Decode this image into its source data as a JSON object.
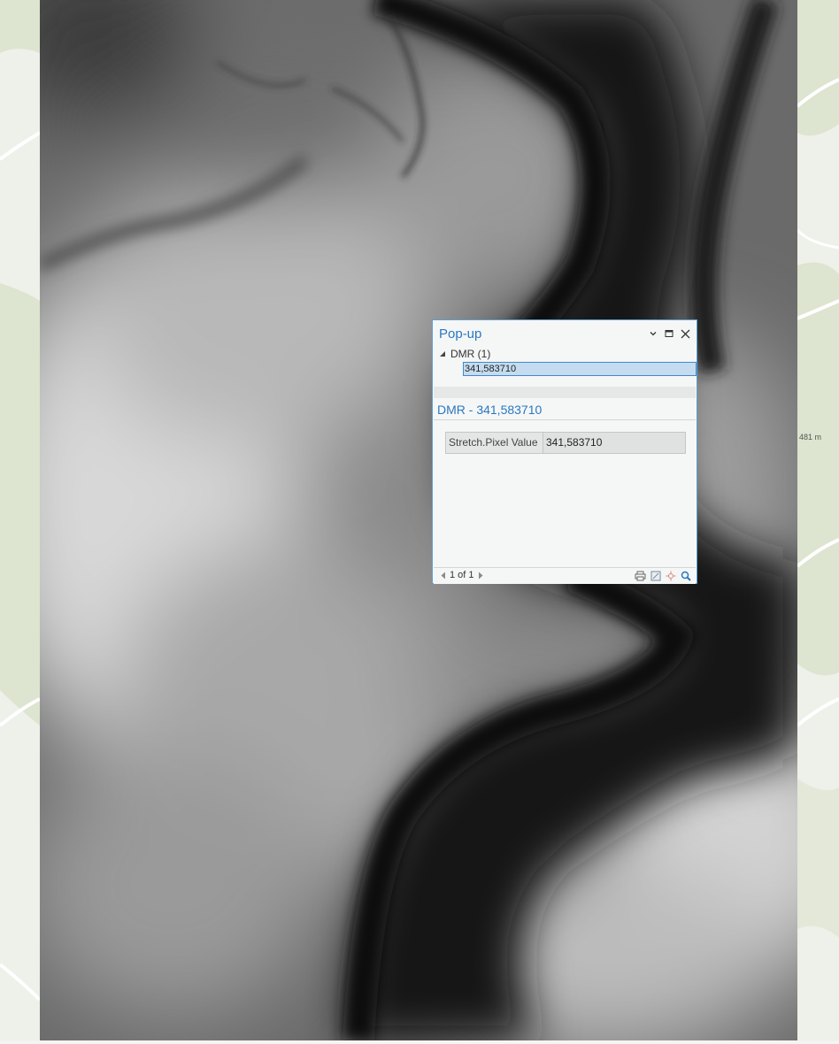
{
  "map": {
    "scale_label": "481 m",
    "colors": {
      "basemap": "#eef0ea",
      "basemap_green": "#dde4cf",
      "road": "#ffffff",
      "dem_light": "#e0e0e0",
      "dem_dark": "#0c0c0c"
    }
  },
  "popup": {
    "title": "Pop-up",
    "controls": {
      "collapse_icon": "chevron-down-icon",
      "maximize_icon": "maximize-icon",
      "close_icon": "close-icon"
    },
    "tree": {
      "layer_label": "DMR (1)",
      "feature_label": "341,583710"
    },
    "feature_header": "DMR - 341,583710",
    "attributes": [
      {
        "name": "Stretch.Pixel Value",
        "value": "341,583710"
      }
    ],
    "footer": {
      "pager_text": "1 of 1",
      "tools": [
        "print-icon",
        "export-icon",
        "flash-icon",
        "zoom-to-icon"
      ]
    },
    "accent_color": "#2a78c0",
    "selection_color": "#c5dcf0"
  }
}
